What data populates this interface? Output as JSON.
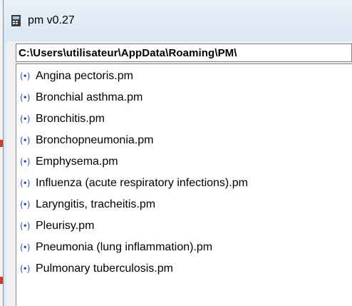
{
  "window": {
    "title": "pm v0.27",
    "icon": "app-document-icon"
  },
  "path": {
    "value": "C:\\Users\\utilisateur\\AppData\\Roaming\\PM\\"
  },
  "files": {
    "icon": "pm-file-icon",
    "icon_glyph": "(•)",
    "icon_color": "#1d52c9",
    "items": [
      {
        "label": "Angina pectoris.pm"
      },
      {
        "label": "Bronchial asthma.pm"
      },
      {
        "label": "Bronchitis.pm"
      },
      {
        "label": "Bronchopneumonia.pm"
      },
      {
        "label": "Emphysema.pm"
      },
      {
        "label": "Influenza (acute respiratory infections).pm"
      },
      {
        "label": "Laryngitis, tracheitis.pm"
      },
      {
        "label": "Pleurisy.pm"
      },
      {
        "label": "Pneumonia (lung inflammation).pm"
      },
      {
        "label": "Pulmonary tuberculosis.pm"
      }
    ]
  }
}
